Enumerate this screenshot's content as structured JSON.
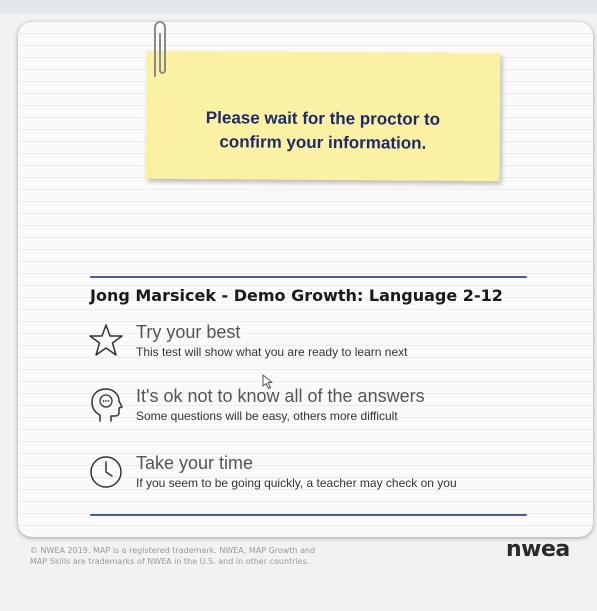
{
  "note": {
    "line1": "Please wait for the proctor to",
    "line2": "confirm your information."
  },
  "test": {
    "title": "Jong Marsicek - Demo Growth: Language 2-12"
  },
  "tips": [
    {
      "icon": "star-icon",
      "heading": "Try your best",
      "description": "This test will show what you are ready to learn next"
    },
    {
      "icon": "thinking-head-icon",
      "heading": "It's ok not to know all of the answers",
      "description": "Some questions will be easy, others more difficult"
    },
    {
      "icon": "clock-icon",
      "heading": "Take your time",
      "description": "If you seem to be going quickly, a teacher may check on you"
    }
  ],
  "footer": {
    "legal_line1": "© NWEA 2019. MAP is a registered trademark. NWEA, MAP Growth and",
    "legal_line2": "MAP Skills are trademarks of NWEA in the U.S. and in other countries.",
    "logo": "nwea"
  },
  "colors": {
    "note_background": "#fbf1a3",
    "note_text": "#1c2a6e",
    "rule": "#4b5a92"
  }
}
